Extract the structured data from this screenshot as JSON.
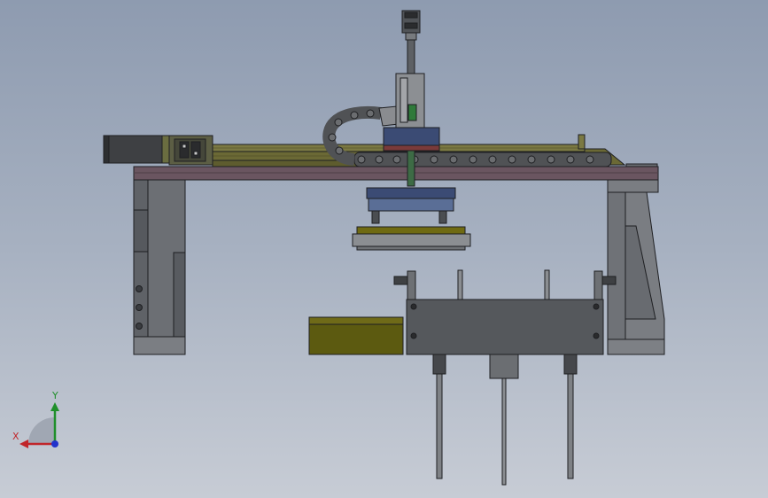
{
  "viewport": {
    "background_top": "#8e9bb0",
    "background_bottom": "#c7ccd5"
  },
  "colors": {
    "steel": "#6f7278",
    "steel_dark": "#55585d",
    "steel_light": "#8a8d92",
    "beam": "#6a5560",
    "olive": "#74723a",
    "olive_bright": "#6f6a12",
    "blue": "#3b4b74",
    "chain": "#55575a",
    "outline": "#1e1f22"
  },
  "triad": {
    "x_label": "X",
    "y_label": "Y",
    "x_color": "#c0262b",
    "y_color": "#1f8f2a",
    "z_color": "#2233cc"
  }
}
